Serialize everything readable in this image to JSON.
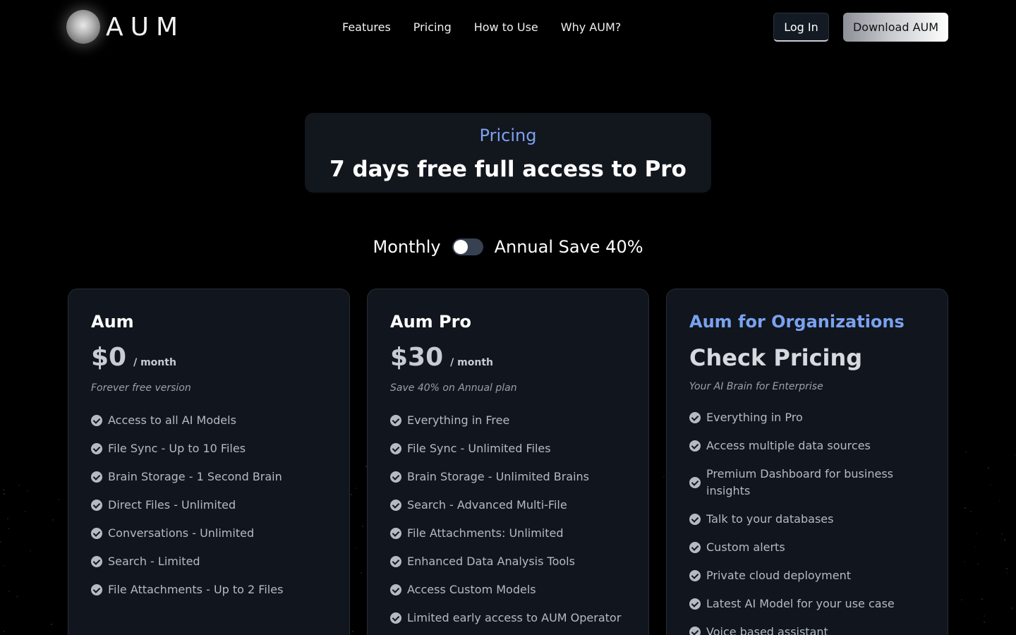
{
  "brand": {
    "name": "AUM"
  },
  "nav": {
    "items": [
      {
        "label": "Features"
      },
      {
        "label": "Pricing"
      },
      {
        "label": "How to Use"
      },
      {
        "label": "Why AUM?"
      }
    ]
  },
  "header": {
    "login_label": "Log In",
    "download_label": "Download AUM"
  },
  "hero": {
    "eyebrow": "Pricing",
    "title": "7 days free full access to Pro"
  },
  "billing": {
    "monthly_label": "Monthly",
    "annual_label": "Annual Save 40%",
    "annual_selected": false
  },
  "plans": [
    {
      "name": "Aum",
      "price": "$0",
      "period": "/ month",
      "subtitle": "Forever free version",
      "features": [
        "Access to all AI Models",
        "File Sync - Up to 10 Files",
        "Brain Storage - 1 Second Brain",
        "Direct Files - Unlimited",
        "Conversations - Unlimited",
        "Search - Limited",
        "File Attachments - Up to 2 Files"
      ]
    },
    {
      "name": "Aum Pro",
      "price": "$30",
      "period": "/ month",
      "subtitle": "Save 40% on Annual plan",
      "features": [
        "Everything in Free",
        "File Sync - Unlimited Files",
        "Brain Storage - Unlimited Brains",
        "Search - Advanced Multi-File",
        "File Attachments: Unlimited",
        "Enhanced Data Analysis Tools",
        "Access Custom Models",
        "Limited early access to AUM Operator"
      ]
    },
    {
      "name": "Aum for Organizations",
      "price": "Check Pricing",
      "subtitle": "Your AI Brain for Enterprise",
      "features": [
        "Everything in Pro",
        "Access multiple data sources",
        "Premium Dashboard for business insights",
        "Talk to your databases",
        "Custom alerts",
        "Private cloud deployment",
        "Latest AI Model for your use case",
        "Voice based assistant"
      ]
    }
  ],
  "colors": {
    "background": "#000000",
    "card": "#11151d",
    "accent_blue": "#7aa2f0",
    "muted_text": "#b5bac3"
  }
}
